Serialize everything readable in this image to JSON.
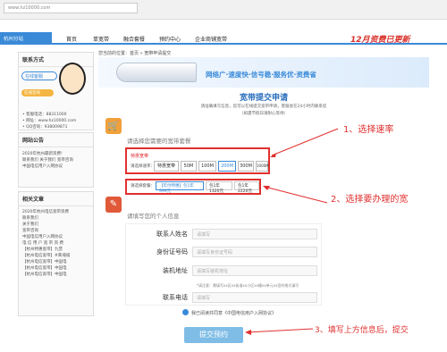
{
  "browser": {
    "url": "www.hz10000.com"
  },
  "header": {
    "brand": "杭州分站",
    "nav": [
      "首页",
      "单宽带",
      "融合套餐",
      "预约中心",
      "企业商铺宽带"
    ],
    "promo": "12月资费已更新"
  },
  "sidebar": {
    "contact_title": "联系方式",
    "phone_button": "在线客服",
    "online_button": "在线咨询",
    "contact_lines": [
      "• 客服电话：88311000",
      "• 网址：www.hz10000.com",
      "• QQ咨询：938009871"
    ],
    "notice_title": "网站公告",
    "notice_lines": [
      "2020年杭州最新资费!",
      "联系我们  关于我们  宽带咨询",
      "中国电信用户入网协议"
    ],
    "related_title": "相关文章",
    "related_lines": [
      "2020年杭州电信宽带资费",
      "联系我们",
      "关于我们",
      "宽带咨询",
      "中国电信用户入网协议",
      "电 信 用 户 宽 带 资 费",
      "【杭州特惠宽带】九堡",
      "【杭州电信宽带】#黄埔城",
      "【杭州电信宽带】中国电",
      "【杭州电信宽带】中国电",
      "【杭州电信宽带】中国电"
    ]
  },
  "breadcrumb": "您当前的位置：首页 » 宽带申请提交",
  "hero": {
    "slogan": "网络广·速度快·信号稳·服务优·资费省"
  },
  "form": {
    "title": "宽带提交申请",
    "intro1": "请准确填写信息，您可以在线提交宽带申请，客服会在24小时内联系您",
    "intro2": "（如遇节假日请耐心等待）",
    "step1_title": "请选择您需要的宽带套餐",
    "hot_tag": "特惠宽带",
    "rate_label": "请选择速率：",
    "rates": [
      "特惠宽带",
      "50M",
      "100M",
      "200M",
      "300M",
      "1000M"
    ],
    "package_label": "请选择套餐：",
    "packages": [
      "【年付特惠】包1年999元",
      "包1年1320元",
      "包1年2220元"
    ],
    "step2_title": "请填写您的个人信息",
    "fields": [
      {
        "label": "联系人姓名",
        "placeholder": "请填写"
      },
      {
        "label": "身份证号码",
        "placeholder": "请填写身份证号码"
      },
      {
        "label": "装机地址",
        "placeholder": "请填写装机地址"
      },
      {
        "label": "联系电话",
        "placeholder": "请填写"
      }
    ],
    "address_hint": "*请注意：需填写xx区xx街道xx小区xx幢xx单元xx室的格式填写",
    "agree_text": "我已阅读并同意《中国电信用户入网协议》",
    "submit": "提交预约"
  },
  "annotations": {
    "a1": "1、选择速率",
    "a2": "2、选择要办理的宽",
    "a3": "3、填写上方信息后，提交"
  },
  "colors": {
    "accent": "#3a8ad8",
    "annotation": "#e0302f"
  }
}
